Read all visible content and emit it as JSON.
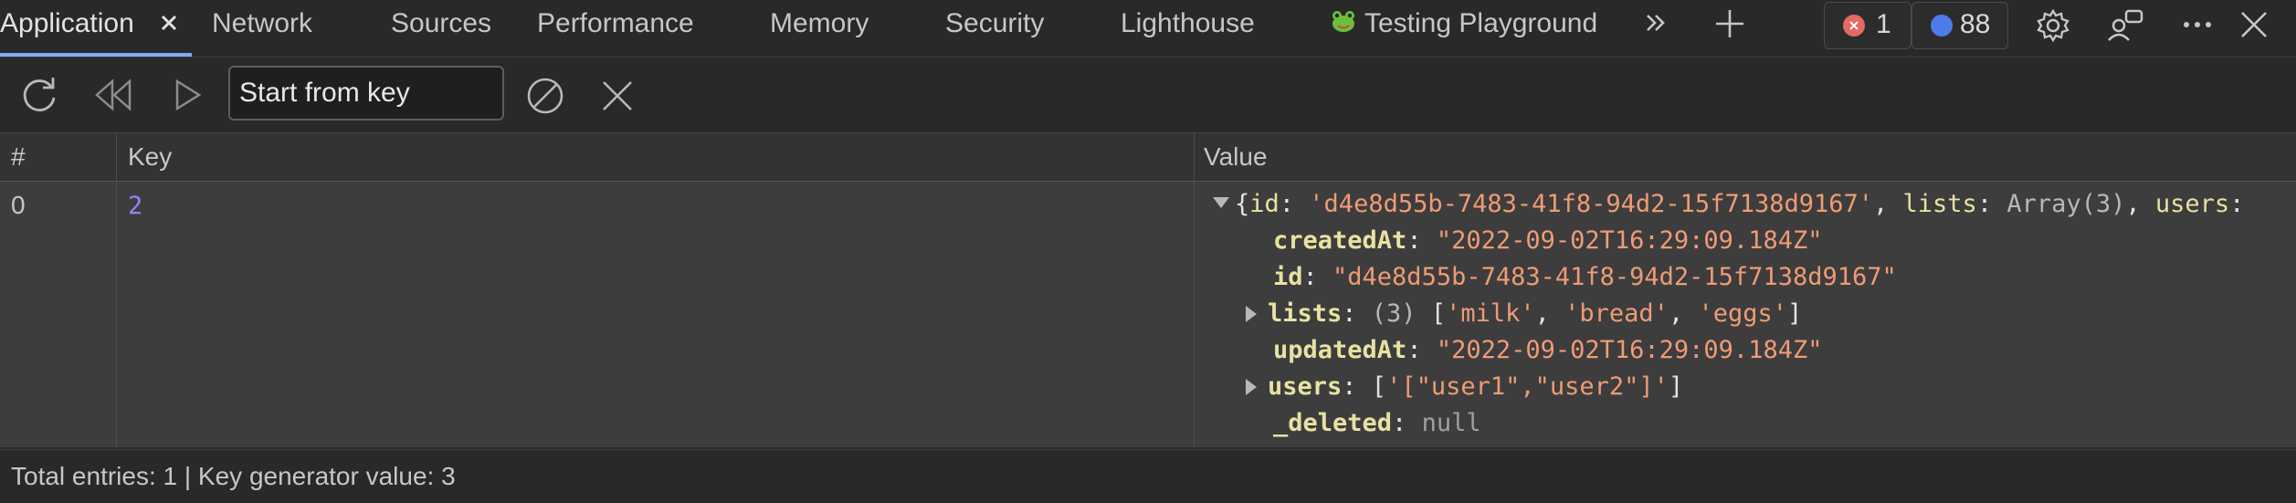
{
  "tabs": {
    "application": "Application",
    "network": "Network",
    "sources": "Sources",
    "performance": "Performance",
    "memory": "Memory",
    "security": "Security",
    "lighthouse": "Lighthouse",
    "testing_playground": "Testing Playground"
  },
  "badges": {
    "errors": "1",
    "issues": "88"
  },
  "toolbar": {
    "search_placeholder": "Start from key"
  },
  "table": {
    "headers": {
      "index": "#",
      "key": "Key",
      "value": "Value"
    },
    "row": {
      "index": "0",
      "key": "2",
      "summary": {
        "open": "{",
        "id_key": "id",
        "id_val": "'d4e8d55b-7483-41f8-94d2-15f7138d9167'",
        "lists_key": "lists",
        "lists_val": "Array(3)",
        "users_key": "users"
      },
      "props": [
        {
          "key": "createdAt",
          "value": "\"2022-09-02T16:29:09.184Z\""
        },
        {
          "key": "id",
          "value": "\"d4e8d55b-7483-41f8-94d2-15f7138d9167\""
        },
        {
          "key": "lists",
          "count": "(3)",
          "items": [
            "'milk'",
            "'bread'",
            "'eggs'"
          ]
        },
        {
          "key": "updatedAt",
          "value": "\"2022-09-02T16:29:09.184Z\""
        },
        {
          "key": "users",
          "value": "'[\"user1\",\"user2\"]'"
        },
        {
          "key": "_deleted",
          "value": "null"
        }
      ]
    }
  },
  "footer": {
    "status": "Total entries: 1 | Key generator value: 3"
  },
  "colors": {
    "accent": "#7cacf8",
    "string": "#ef9b76",
    "key": "#e8e1a2",
    "error": "#e46962",
    "issue": "#4d7ce8"
  }
}
